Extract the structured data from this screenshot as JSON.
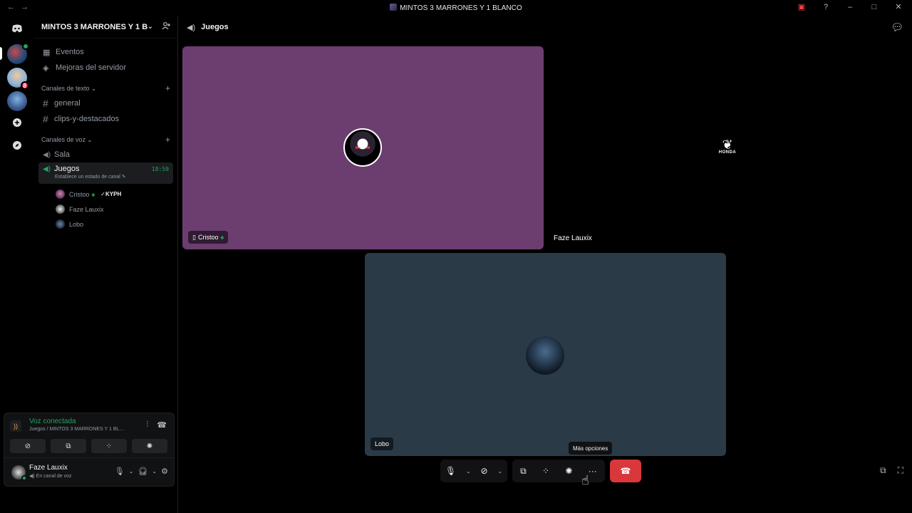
{
  "titlebar": {
    "back": "←",
    "forward": "→",
    "title": "MINTOS 3 MARRONES Y 1 BLANCO"
  },
  "rail": {
    "badge_server2": "8"
  },
  "sidebar": {
    "server_name": "MINTOS 3 MARRONES Y 1 B...",
    "events": "Eventos",
    "boost": "Mejoras del servidor",
    "text_category": "Canales de texto",
    "text_channels": [
      "general",
      "clips-y-destacados"
    ],
    "voice_category": "Canales de voz",
    "voice_channels": [
      "Sala",
      "Juegos"
    ],
    "active_time": "18:59",
    "active_status": "Establece un estado de canal",
    "members": [
      {
        "name": "Cristoo",
        "tag": "KYPH"
      },
      {
        "name": "Faze Lauxix"
      },
      {
        "name": "Lobo"
      }
    ]
  },
  "voice_panel": {
    "title": "Voz conectada",
    "subtitle": "Juegos / MINTOS 3 MARRONES Y 1 BL..."
  },
  "user_panel": {
    "name": "Faze Lauxix",
    "status": "En canal de voz"
  },
  "main": {
    "channel": "Juegos",
    "tiles": [
      {
        "name": "Cristoo",
        "bg": "#6c3d6f"
      },
      {
        "name": "Faze Lauxix",
        "bg": "#000000"
      },
      {
        "name": "Lobo",
        "bg": "#2b3a47"
      }
    ],
    "honda_label": "HONDA"
  },
  "controls": {
    "tooltip": "Más opciones",
    "more": "···"
  },
  "colors": {
    "accent_green": "#23a55a",
    "leave_red": "#da373c",
    "badge_red": "#e22b43"
  }
}
